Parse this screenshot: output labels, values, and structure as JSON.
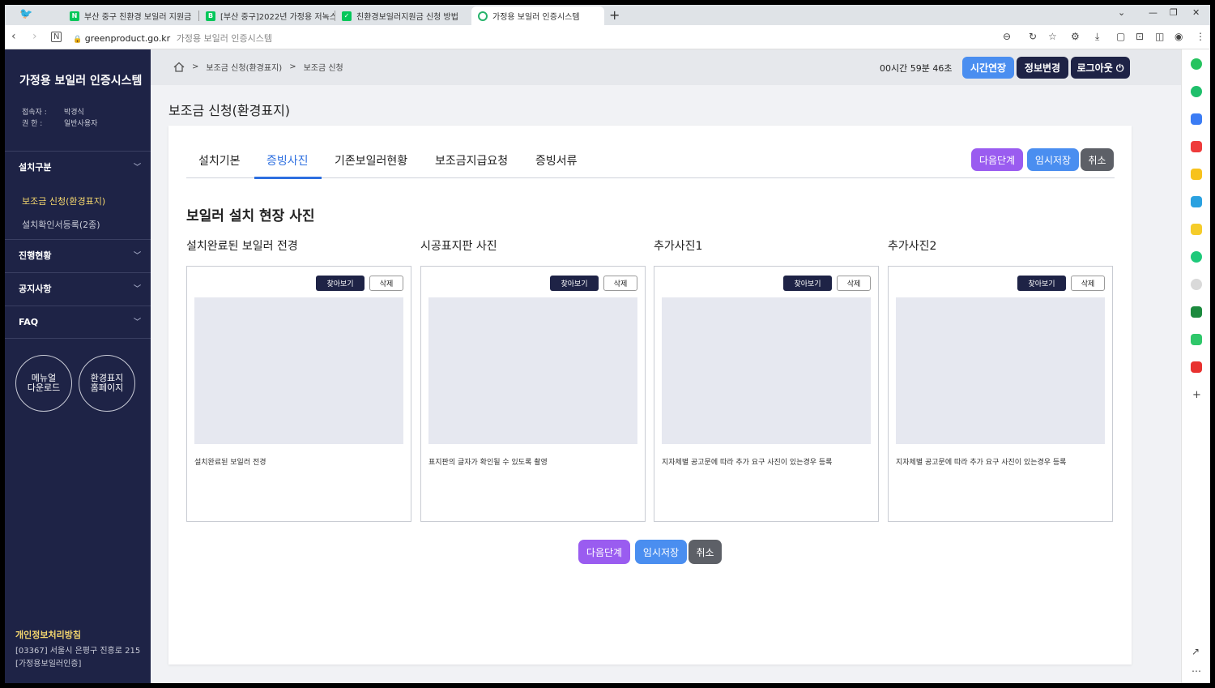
{
  "browser": {
    "tabs": [
      {
        "title": "부산 중구 친환경 보일러 지원금",
        "fav_color": "#03c75a",
        "fav_text": "N"
      },
      {
        "title": "[부산 중구]2022년 가정용 저녹스",
        "fav_color": "#03c75a",
        "fav_text": "B"
      },
      {
        "title": "친환경보일러지원금 신청 방법",
        "fav_color": "#03c75a",
        "fav_text": "✓"
      },
      {
        "title": "가정용 보일러 인증시스템",
        "fav_color": "#26b36b",
        "fav_text": ""
      }
    ],
    "url": "greenproduct.go.kr",
    "page_title": "가정용 보일러 인증시스템"
  },
  "sidebar": {
    "brand": "가정용 보일러 인증시스템",
    "user_label": "접속자 :",
    "user_value": "박경식",
    "role_label": "권   한 :",
    "role_value": "일반사용자",
    "sections": [
      {
        "label": "설치구분"
      },
      {
        "label": "진행현황"
      },
      {
        "label": "공지사항"
      },
      {
        "label": "FAQ"
      }
    ],
    "sub_items": [
      {
        "label": "보조금 신청(환경표지)",
        "active": true
      },
      {
        "label": "설치확인서등록(2종)",
        "active": false
      }
    ],
    "circle_buttons": [
      {
        "label": "메뉴얼\n다운로드"
      },
      {
        "label": "환경표지\n홈페이지"
      }
    ],
    "privacy": "개인정보처리방침",
    "address": "[03367] 서울시 은평구 진흥로 215 [가정용보일러인증]"
  },
  "topbar": {
    "breadcrumb": [
      "보조금 신청(환경표지)",
      "보조금 신청"
    ],
    "timer": "00시간 59분 46초",
    "buttons": [
      {
        "label": "시간연장",
        "color": "#4a8ef0"
      },
      {
        "label": "정보변경",
        "color": "#1e2346"
      },
      {
        "label": "로그아웃 ⏻",
        "color": "#1e2346"
      }
    ]
  },
  "page": {
    "title": "보조금 신청(환경표지)",
    "tabs": [
      "설치기본",
      "증빙사진",
      "기존보일러현황",
      "보조금지급요청",
      "증빙서류"
    ],
    "active_tab": "증빙사진",
    "actions": [
      {
        "label": "다음단계",
        "color": "#9a5cf0"
      },
      {
        "label": "임시저장",
        "color": "#4a8ef0"
      },
      {
        "label": "취소",
        "color": "#5d6067"
      }
    ],
    "section_title": "보일러 설치 현장 사진",
    "photos": [
      {
        "label": "설치완료된 보일러 전경",
        "description": "설치완료된 보일러 전경"
      },
      {
        "label": "시공표지판 사진",
        "description": "표지판의 글자가 확인될 수 있도록 촬영"
      },
      {
        "label": "추가사진1",
        "description": "지자체별 공고문에 따라 추가 요구 사진이 있는경우 등록"
      },
      {
        "label": "추가사진2",
        "description": "지자체별 공고문에 따라 추가 요구 사진이 있는경우 등록"
      }
    ],
    "find_label": "찾아보기",
    "delete_label": "삭제"
  }
}
